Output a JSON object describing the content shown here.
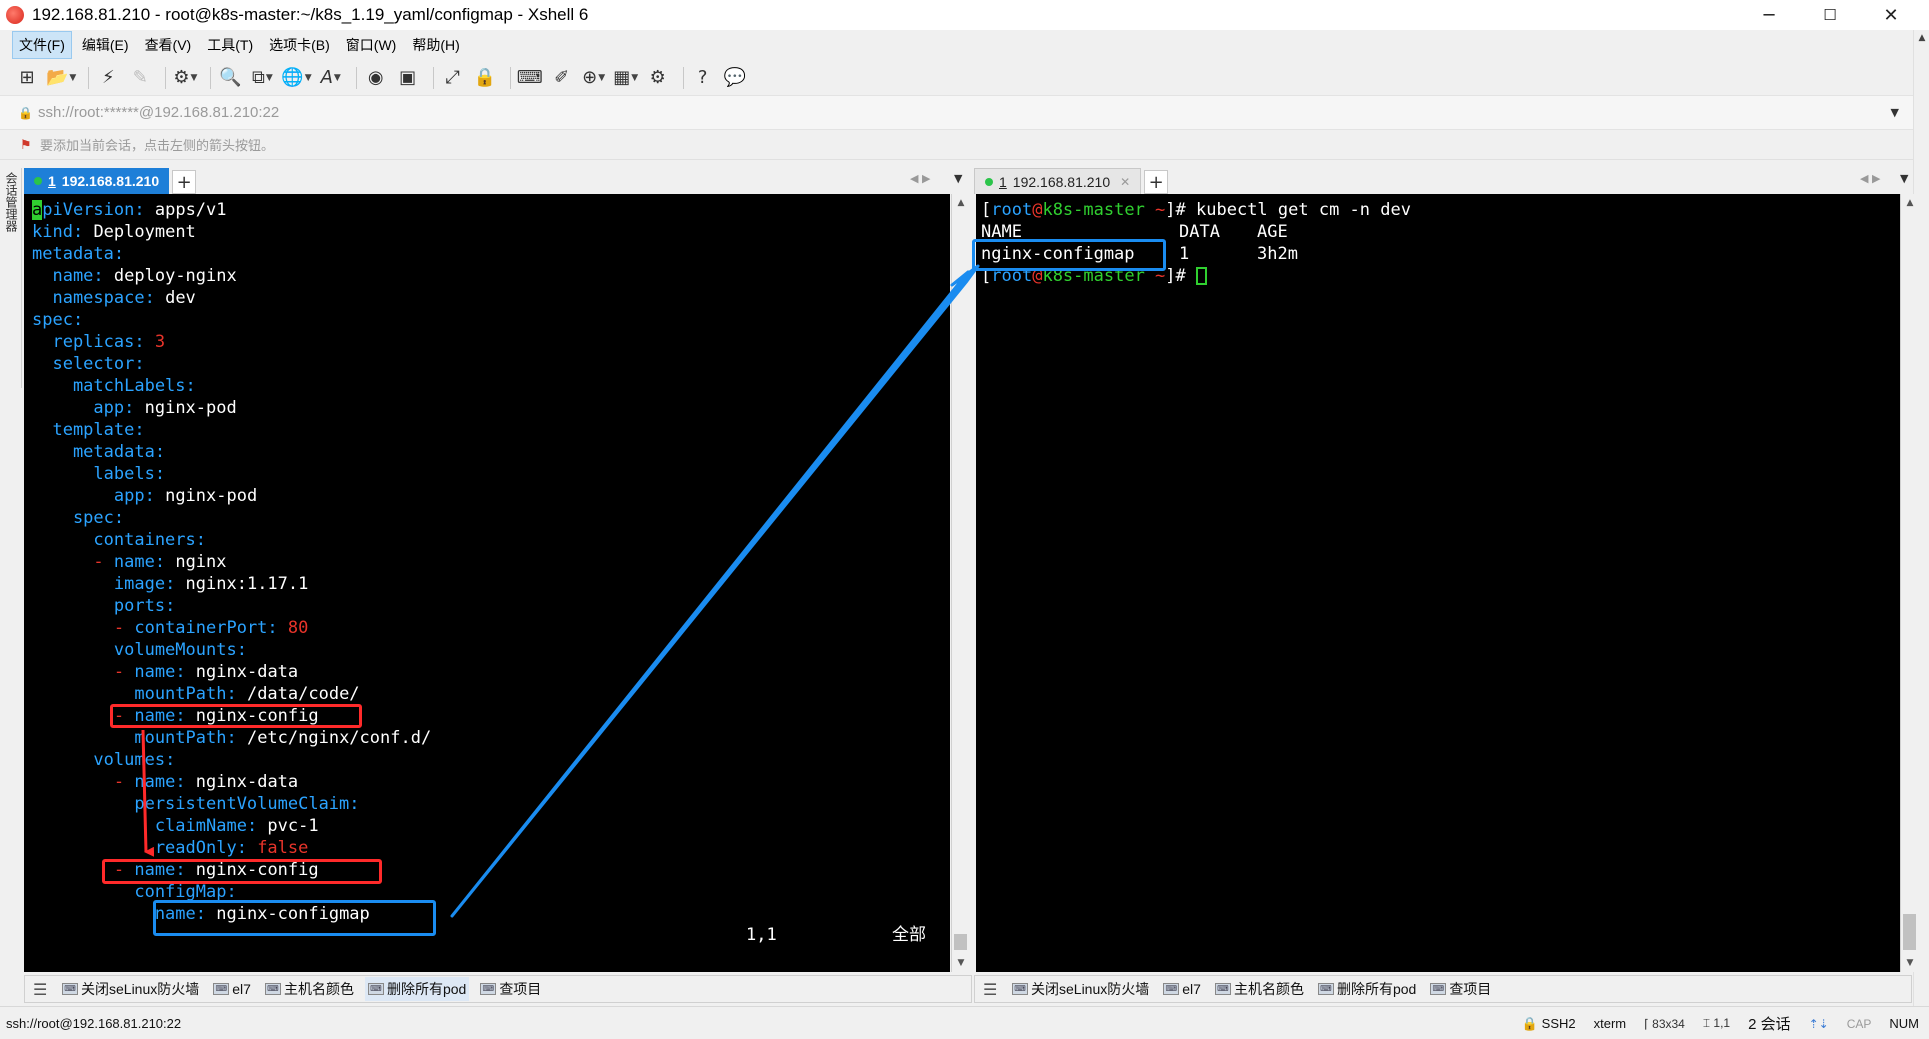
{
  "window": {
    "title": "192.168.81.210 - root@k8s-master:~/k8s_1.19_yaml/configmap - Xshell 6",
    "controls": {
      "minimize": "─",
      "maximize": "☐",
      "close": "✕"
    }
  },
  "menu": {
    "items": [
      {
        "label": "文件(F)"
      },
      {
        "label": "编辑(E)"
      },
      {
        "label": "查看(V)"
      },
      {
        "label": "工具(T)"
      },
      {
        "label": "选项卡(B)"
      },
      {
        "label": "窗口(W)"
      },
      {
        "label": "帮助(H)"
      }
    ]
  },
  "address": {
    "value": "ssh://root:******@192.168.81.210:22"
  },
  "hint": {
    "text": "要添加当前会话，点击左侧的箭头按钮。"
  },
  "session_sidebar": {
    "label": "会话管理器"
  },
  "left_pane": {
    "tab": {
      "number": "1",
      "label": "192.168.81.210"
    },
    "editor_status": {
      "position": "1,1",
      "scope": "全部"
    },
    "yaml_lines": [
      [
        {
          "t": "a",
          "c": "cursor-block"
        },
        {
          "t": "piVersion",
          "c": "k"
        },
        {
          "t": ": ",
          "c": "k"
        },
        {
          "t": "apps/v1",
          "c": "v"
        }
      ],
      [
        {
          "t": "kind",
          "c": "k"
        },
        {
          "t": ": ",
          "c": "k"
        },
        {
          "t": "Deployment",
          "c": "v"
        }
      ],
      [
        {
          "t": "metadata",
          "c": "k"
        },
        {
          "t": ":",
          "c": "k"
        }
      ],
      [
        {
          "t": "  name",
          "c": "k"
        },
        {
          "t": ": ",
          "c": "k"
        },
        {
          "t": "deploy-nginx",
          "c": "v"
        }
      ],
      [
        {
          "t": "  namespace",
          "c": "k"
        },
        {
          "t": ": ",
          "c": "k"
        },
        {
          "t": "dev",
          "c": "v"
        }
      ],
      [
        {
          "t": "spec",
          "c": "k"
        },
        {
          "t": ":",
          "c": "k"
        }
      ],
      [
        {
          "t": "  replicas",
          "c": "k"
        },
        {
          "t": ": ",
          "c": "k"
        },
        {
          "t": "3",
          "c": "num"
        }
      ],
      [
        {
          "t": "  selector",
          "c": "k"
        },
        {
          "t": ":",
          "c": "k"
        }
      ],
      [
        {
          "t": "    matchLabels",
          "c": "k"
        },
        {
          "t": ":",
          "c": "k"
        }
      ],
      [
        {
          "t": "      app",
          "c": "k"
        },
        {
          "t": ": ",
          "c": "k"
        },
        {
          "t": "nginx-pod",
          "c": "v"
        }
      ],
      [
        {
          "t": "  template",
          "c": "k"
        },
        {
          "t": ":",
          "c": "k"
        }
      ],
      [
        {
          "t": "    metadata",
          "c": "k"
        },
        {
          "t": ":",
          "c": "k"
        }
      ],
      [
        {
          "t": "      labels",
          "c": "k"
        },
        {
          "t": ":",
          "c": "k"
        }
      ],
      [
        {
          "t": "        app",
          "c": "k"
        },
        {
          "t": ": ",
          "c": "k"
        },
        {
          "t": "nginx-pod",
          "c": "v"
        }
      ],
      [
        {
          "t": "    spec",
          "c": "k"
        },
        {
          "t": ":",
          "c": "k"
        }
      ],
      [
        {
          "t": "      containers",
          "c": "k"
        },
        {
          "t": ":",
          "c": "k"
        }
      ],
      [
        {
          "t": "      - ",
          "c": "f"
        },
        {
          "t": "name",
          "c": "k"
        },
        {
          "t": ": ",
          "c": "k"
        },
        {
          "t": "nginx",
          "c": "v"
        }
      ],
      [
        {
          "t": "        image",
          "c": "k"
        },
        {
          "t": ": ",
          "c": "k"
        },
        {
          "t": "nginx:1.17.1",
          "c": "v"
        }
      ],
      [
        {
          "t": "        ports",
          "c": "k"
        },
        {
          "t": ":",
          "c": "k"
        }
      ],
      [
        {
          "t": "        - ",
          "c": "f"
        },
        {
          "t": "containerPort",
          "c": "k"
        },
        {
          "t": ": ",
          "c": "k"
        },
        {
          "t": "80",
          "c": "num"
        }
      ],
      [
        {
          "t": "        volumeMounts",
          "c": "k"
        },
        {
          "t": ":",
          "c": "k"
        }
      ],
      [
        {
          "t": "        - ",
          "c": "f"
        },
        {
          "t": "name",
          "c": "k"
        },
        {
          "t": ": ",
          "c": "k"
        },
        {
          "t": "nginx-data",
          "c": "v"
        }
      ],
      [
        {
          "t": "          mountPath",
          "c": "k"
        },
        {
          "t": ": ",
          "c": "k"
        },
        {
          "t": "/data/code/",
          "c": "v"
        }
      ],
      [
        {
          "t": "        - ",
          "c": "f"
        },
        {
          "t": "name",
          "c": "k"
        },
        {
          "t": ": ",
          "c": "k"
        },
        {
          "t": "nginx-config",
          "c": "v"
        }
      ],
      [
        {
          "t": "          mountPath",
          "c": "k"
        },
        {
          "t": ": ",
          "c": "k"
        },
        {
          "t": "/etc/nginx/conf.d/",
          "c": "v"
        }
      ],
      [
        {
          "t": "      volumes",
          "c": "k"
        },
        {
          "t": ":",
          "c": "k"
        }
      ],
      [
        {
          "t": "        - ",
          "c": "f"
        },
        {
          "t": "name",
          "c": "k"
        },
        {
          "t": ": ",
          "c": "k"
        },
        {
          "t": "nginx-data",
          "c": "v"
        }
      ],
      [
        {
          "t": "          persistentVolumeClaim",
          "c": "k"
        },
        {
          "t": ":",
          "c": "k"
        }
      ],
      [
        {
          "t": "            claimName",
          "c": "k"
        },
        {
          "t": ": ",
          "c": "k"
        },
        {
          "t": "pvc-1",
          "c": "v"
        }
      ],
      [
        {
          "t": "            readOnly",
          "c": "k"
        },
        {
          "t": ": ",
          "c": "k"
        },
        {
          "t": "false",
          "c": "f"
        }
      ],
      [
        {
          "t": "        - ",
          "c": "f"
        },
        {
          "t": "name",
          "c": "k"
        },
        {
          "t": ": ",
          "c": "k"
        },
        {
          "t": "nginx-config",
          "c": "v"
        }
      ],
      [
        {
          "t": "          configMap",
          "c": "k"
        },
        {
          "t": ":",
          "c": "k"
        }
      ],
      [
        {
          "t": "            name",
          "c": "k"
        },
        {
          "t": ": ",
          "c": "k"
        },
        {
          "t": "nginx-configmap",
          "c": "v"
        }
      ]
    ]
  },
  "right_pane": {
    "tab": {
      "number": "1",
      "label": "192.168.81.210"
    },
    "prompt": {
      "open": "[",
      "user": "root",
      "at": "@",
      "host": "k8s-master",
      "dir": " ~",
      "close": "]# "
    },
    "command": "kubectl get cm -n dev",
    "table": {
      "headers": [
        "NAME",
        "DATA",
        "AGE"
      ],
      "rows": [
        [
          "nginx-configmap",
          "1",
          "3h2m"
        ]
      ]
    }
  },
  "quickbar": {
    "items": [
      {
        "label": "关闭seLinux防火墙"
      },
      {
        "label": "el7"
      },
      {
        "label": "主机名颜色"
      },
      {
        "label": "删除所有pod"
      },
      {
        "label": "查项目"
      }
    ]
  },
  "status": {
    "connection": "ssh://root@192.168.81.210:22",
    "protocol": "SSH2",
    "terminal": "xterm",
    "size": "83x34",
    "cursor": "1,1",
    "sessions": "2 会话",
    "cap": "CAP",
    "num": "NUM"
  },
  "colors": {
    "terminal_bg": "#000000",
    "yaml_key": "#2ba3ff",
    "yaml_value": "#ffffff",
    "yaml_number": "#e8342a",
    "prompt_host": "#30d030",
    "annotation_red": "#ff2a2a",
    "annotation_blue": "#1a8cf0",
    "active_tab": "#1e7fd8"
  }
}
